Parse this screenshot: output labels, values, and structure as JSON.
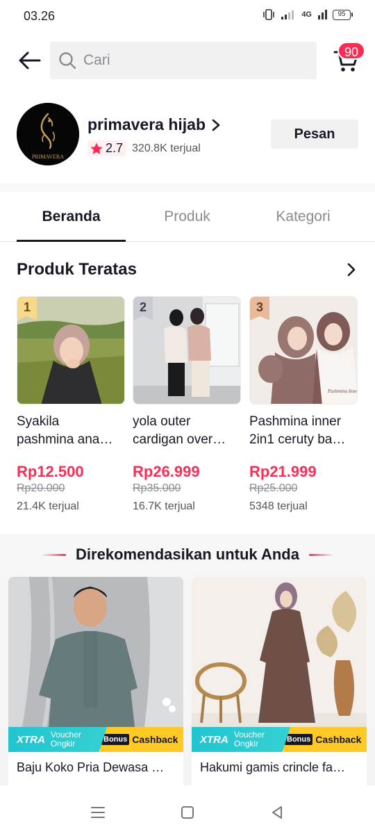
{
  "status_bar": {
    "time": "03.26",
    "network": "4G",
    "battery": "95"
  },
  "header": {
    "back_icon": "arrow-left-icon",
    "search": {
      "placeholder": "Cari",
      "value": ""
    },
    "cart_icon": "cart-icon",
    "cart_count": "90"
  },
  "shop": {
    "name": "primavera hijab",
    "avatar_text": "PRIMAVERA",
    "rating": "2.7",
    "sold": "320.8K terjual",
    "order_button": "Pesan"
  },
  "tabs": [
    {
      "label": "Beranda",
      "active": true
    },
    {
      "label": "Produk",
      "active": false
    },
    {
      "label": "Kategori",
      "active": false
    }
  ],
  "top_products": {
    "title": "Produk Teratas",
    "items": [
      {
        "rank": "1",
        "name_line1": "Syakila",
        "name_line2": "pashmina ana…",
        "price": "Rp12.500",
        "original_price": "Rp20.000",
        "sold": "21.4K terjual"
      },
      {
        "rank": "2",
        "name_line1": "yola outer",
        "name_line2": "cardigan over…",
        "price": "Rp26.999",
        "original_price": "Rp35.000",
        "sold": "16.7K terjual"
      },
      {
        "rank": "3",
        "name_line1": "Pashmina inner",
        "name_line2": "2in1 ceruty ba…",
        "price": "Rp21.999",
        "original_price": "Rp25.000",
        "sold": "5348 terjual"
      }
    ]
  },
  "recommended": {
    "title": "Direkomendasikan untuk Anda",
    "items": [
      {
        "name": "Baju Koko Pria Dewasa …",
        "promo_xtra": "XTRA",
        "promo_voucher_1": "Voucher",
        "promo_voucher_2": "Ongkir",
        "promo_bonus": "Bonus",
        "promo_cashback": "Cashback"
      },
      {
        "name": "Hakumi gamis crincle fa…",
        "promo_xtra": "XTRA",
        "promo_voucher_1": "Voucher",
        "promo_voucher_2": "Ongkir",
        "promo_bonus": "Bonus",
        "promo_cashback": "Cashback"
      }
    ]
  },
  "colors": {
    "accent": "#fe2c55",
    "rank1": "#f6d98a",
    "rank2": "#c9ccd3",
    "rank3": "#e9b99b",
    "promo_teal": "#22c4cf",
    "promo_yellow": "#ffc928"
  },
  "nav": {
    "menu_icon": "menu-icon",
    "home_icon": "square-home-icon",
    "back_icon": "triangle-back-icon"
  }
}
